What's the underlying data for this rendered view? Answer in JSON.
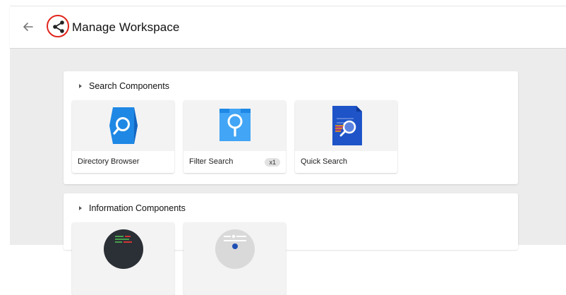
{
  "header": {
    "title": "Manage Workspace",
    "back_icon": "arrow-left-icon",
    "share_icon": "share-icon",
    "highlight_color": "#e0251b"
  },
  "panels": [
    {
      "title": "Search Components",
      "cards": [
        {
          "label": "Directory Browser",
          "icon": "directory-browser-icon"
        },
        {
          "label": "Filter Search",
          "badge": "x1",
          "icon": "filter-search-icon"
        },
        {
          "label": "Quick Search",
          "icon": "quick-search-icon"
        }
      ]
    },
    {
      "title": "Information Components",
      "cards": [
        {
          "icon": "code-editor-icon"
        },
        {
          "icon": "settings-profile-icon"
        }
      ]
    }
  ],
  "colors": {
    "background": "#ececec",
    "card": "#f3f3f3",
    "accent_blue": "#1f88e5"
  }
}
